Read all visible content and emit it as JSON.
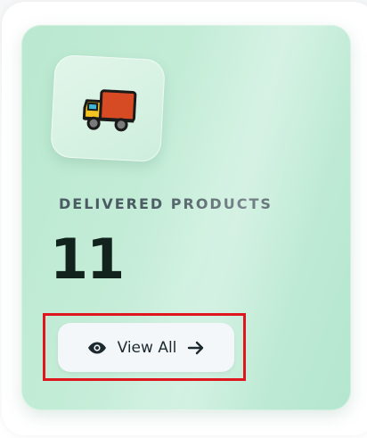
{
  "card": {
    "icon": "delivery-truck-icon",
    "title": "DELIVERED PRODUCTS",
    "count": "11",
    "action": {
      "label": "View All",
      "leading_icon": "eye-icon",
      "trailing_icon": "arrow-right-icon"
    }
  },
  "colors": {
    "card_bg": "#c2ebd6",
    "title": "#4a5b62",
    "count": "#11231c",
    "button_bg": "#f4f7f9",
    "highlight": "#e0161f"
  }
}
